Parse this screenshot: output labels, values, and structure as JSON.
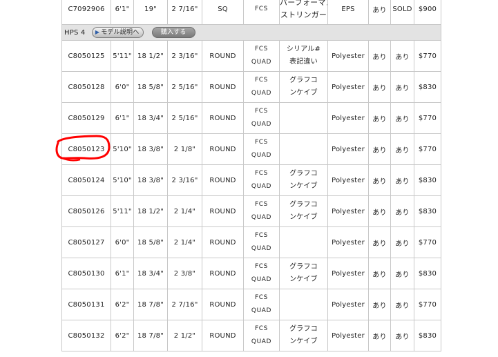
{
  "top_row": {
    "code": "C7092906",
    "length": "6'1\"",
    "width": "19\"",
    "thickness": "2 7/16\"",
    "tail": "SQ",
    "fin": "FCS",
    "note_line1": "パーフォーマンス",
    "note_line2": "ストリンガー",
    "material": "EPS",
    "avail1": "あり",
    "avail2": "SOLD",
    "price": "$900"
  },
  "section": {
    "label": "HPS 4",
    "model_button": "モデル説明へ",
    "buy_button": "購入する"
  },
  "rows": [
    {
      "code": "C8050125",
      "length": "5'11\"",
      "width": "18 1/2\"",
      "thickness": "2 3/16\"",
      "tail": "ROUND",
      "fin1": "FCS",
      "fin2": "QUAD",
      "note1": "シリアル#",
      "note2": "表記違い",
      "material": "Polyester",
      "avail1": "あり",
      "avail2": "あり",
      "price": "$770"
    },
    {
      "code": "C8050128",
      "length": "6'0\"",
      "width": "18 5/8\"",
      "thickness": "2 5/16\"",
      "tail": "ROUND",
      "fin1": "FCS",
      "fin2": "QUAD",
      "note1": "グラフコ",
      "note2": "ンケイブ",
      "material": "Polyester",
      "avail1": "あり",
      "avail2": "あり",
      "price": "$830"
    },
    {
      "code": "C8050129",
      "length": "6'1\"",
      "width": "18 3/4\"",
      "thickness": "2 5/16\"",
      "tail": "ROUND",
      "fin1": "FCS",
      "fin2": "QUAD",
      "note1": "",
      "note2": "",
      "material": "Polyester",
      "avail1": "あり",
      "avail2": "あり",
      "price": "$770"
    },
    {
      "code": "C8050123",
      "length": "5'10\"",
      "width": "18 3/8\"",
      "thickness": "2 1/8\"",
      "tail": "ROUND",
      "fin1": "FCS",
      "fin2": "QUAD",
      "note1": "",
      "note2": "",
      "material": "Polyester",
      "avail1": "あり",
      "avail2": "あり",
      "price": "$770"
    },
    {
      "code": "C8050124",
      "length": "5'10\"",
      "width": "18 3/8\"",
      "thickness": "2 3/16\"",
      "tail": "ROUND",
      "fin1": "FCS",
      "fin2": "QUAD",
      "note1": "グラフコ",
      "note2": "ンケイブ",
      "material": "Polyester",
      "avail1": "あり",
      "avail2": "あり",
      "price": "$830"
    },
    {
      "code": "C8050126",
      "length": "5'11\"",
      "width": "18 1/2\"",
      "thickness": "2 1/4\"",
      "tail": "ROUND",
      "fin1": "FCS",
      "fin2": "QUAD",
      "note1": "グラフコ",
      "note2": "ンケイブ",
      "material": "Polyester",
      "avail1": "あり",
      "avail2": "あり",
      "price": "$830"
    },
    {
      "code": "C8050127",
      "length": "6'0\"",
      "width": "18 5/8\"",
      "thickness": "2 1/4\"",
      "tail": "ROUND",
      "fin1": "FCS",
      "fin2": "QUAD",
      "note1": "",
      "note2": "",
      "material": "Polyester",
      "avail1": "あり",
      "avail2": "あり",
      "price": "$770"
    },
    {
      "code": "C8050130",
      "length": "6'1\"",
      "width": "18 3/4\"",
      "thickness": "2 3/8\"",
      "tail": "ROUND",
      "fin1": "FCS",
      "fin2": "QUAD",
      "note1": "グラフコ",
      "note2": "ンケイブ",
      "material": "Polyester",
      "avail1": "あり",
      "avail2": "あり",
      "price": "$830"
    },
    {
      "code": "C8050131",
      "length": "6'2\"",
      "width": "18 7/8\"",
      "thickness": "2 7/16\"",
      "tail": "ROUND",
      "fin1": "FCS",
      "fin2": "QUAD",
      "note1": "",
      "note2": "",
      "material": "Polyester",
      "avail1": "あり",
      "avail2": "あり",
      "price": "$770"
    },
    {
      "code": "C8050132",
      "length": "6'2\"",
      "width": "18 7/8\"",
      "thickness": "2 1/2\"",
      "tail": "ROUND",
      "fin1": "FCS",
      "fin2": "QUAD",
      "note1": "グラフコ",
      "note2": "ンケイブ",
      "material": "Polyester",
      "avail1": "あり",
      "avail2": "あり",
      "price": "$830"
    }
  ],
  "colors": {
    "link": "#2f7fb1",
    "sold": "#e07a2e",
    "section_bg": "#e3e3e3",
    "annotation": "#ff0000"
  },
  "icons": {
    "model_button_icon": "play-triangle-icon"
  }
}
